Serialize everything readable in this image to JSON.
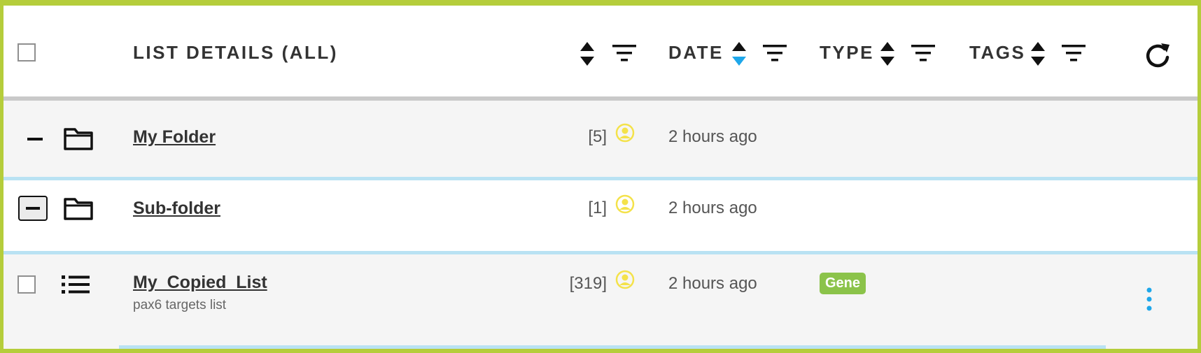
{
  "header": {
    "list_details_label": "LIST DETAILS (ALL)",
    "date_label": "DATE",
    "type_label": "TYPE",
    "tags_label": "TAGS",
    "active_sort_color": "#1ea7ea"
  },
  "rows": [
    {
      "kind": "folder",
      "name": "My Folder",
      "count": "[5]",
      "date": "2 hours ago",
      "expanded": true
    },
    {
      "kind": "folder",
      "name": "Sub-folder",
      "count": "[1]",
      "date": "2 hours ago",
      "expanded": true
    },
    {
      "kind": "list",
      "name": "My_Copied_List",
      "description": "pax6 targets list",
      "count": "[319]",
      "date": "2 hours ago",
      "type_badge": "Gene"
    }
  ],
  "icons": {
    "select_all": "checkbox-icon",
    "sort": "sort-arrows-icon",
    "filter": "filter-icon",
    "refresh": "refresh-icon",
    "collapse": "minus-icon",
    "folder": "folder-icon",
    "list": "list-icon",
    "user": "user-icon",
    "more": "kebab-menu-icon"
  },
  "colors": {
    "frame_border": "#b5cd3b",
    "row_separator": "#b9e2f3",
    "user_icon": "#f4e24a",
    "badge_gene": "#8bc34a",
    "kebab": "#1ea7ea"
  }
}
